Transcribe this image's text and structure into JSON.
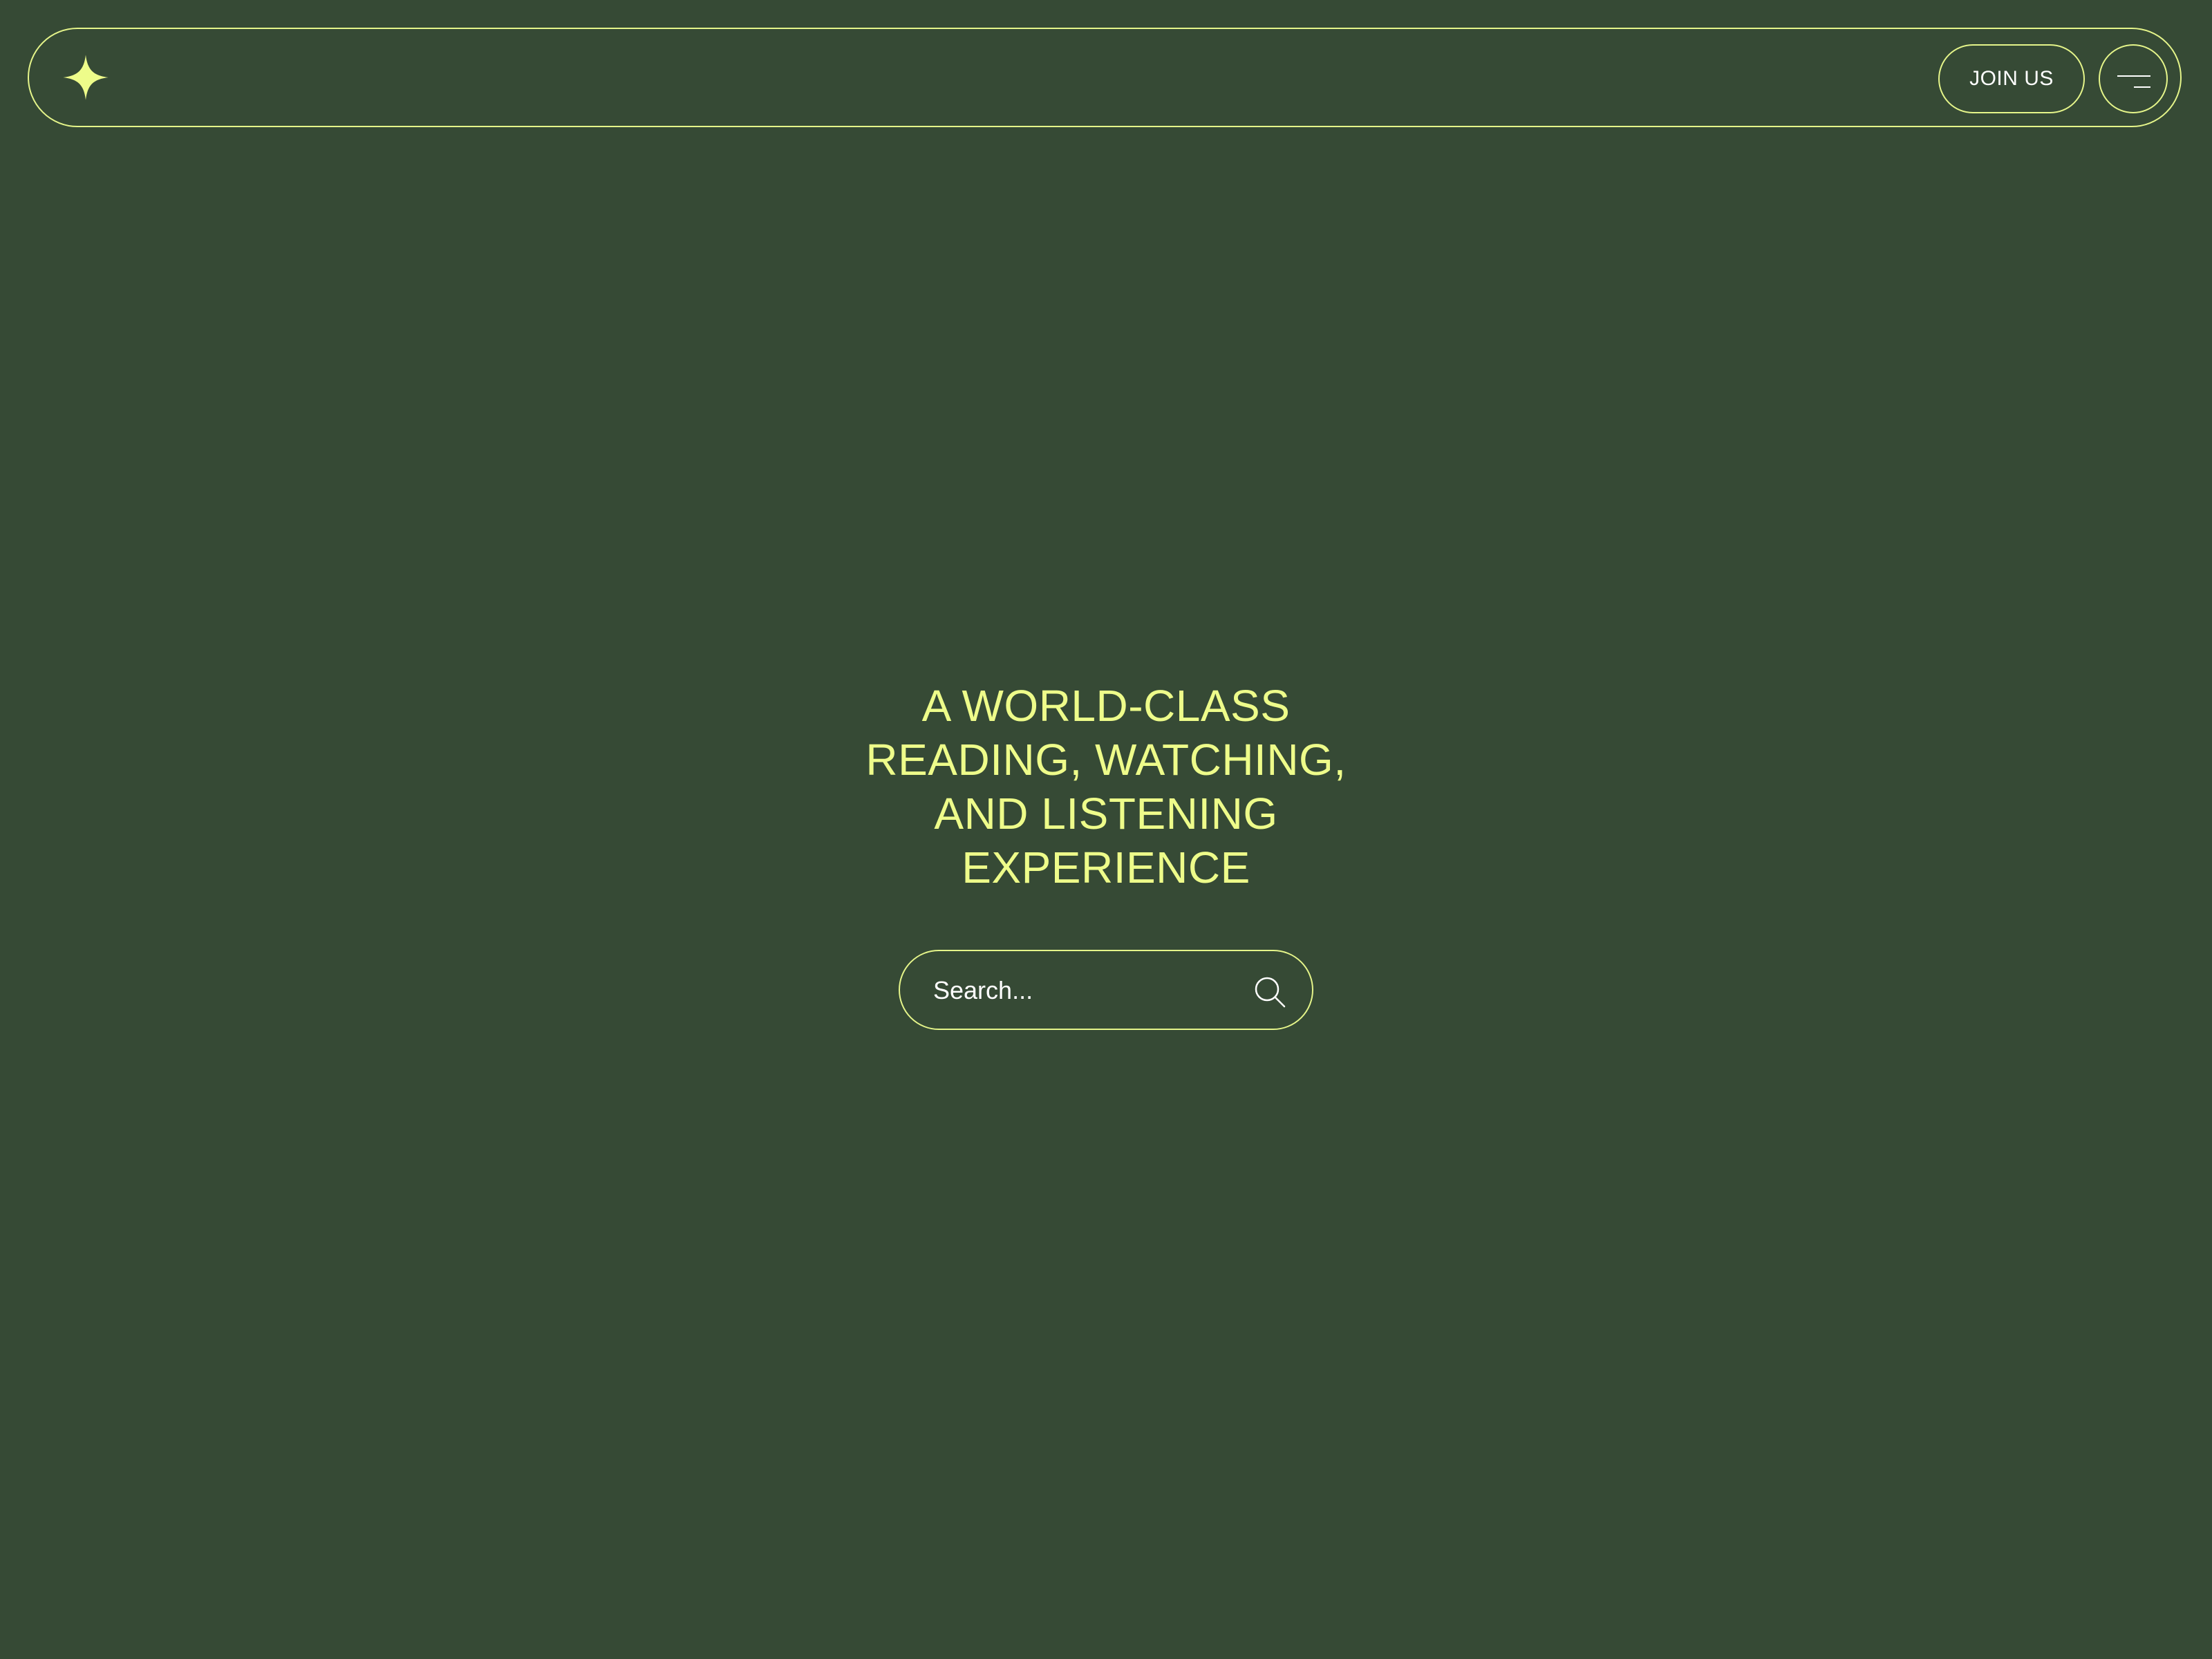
{
  "header": {
    "logo_icon": "four-point-star-icon",
    "join_label": "JOIN US",
    "menu_icon": "hamburger-menu-icon"
  },
  "hero": {
    "title": "A WORLD-CLASS\nREADING, WATCHING,\nAND LISTENING\nEXPERIENCE"
  },
  "search": {
    "placeholder": "Search...",
    "icon": "search-icon"
  },
  "colors": {
    "background": "#364a35",
    "accent": "#eefc8a",
    "border": "#e5f58a",
    "text": "#ffffff"
  }
}
